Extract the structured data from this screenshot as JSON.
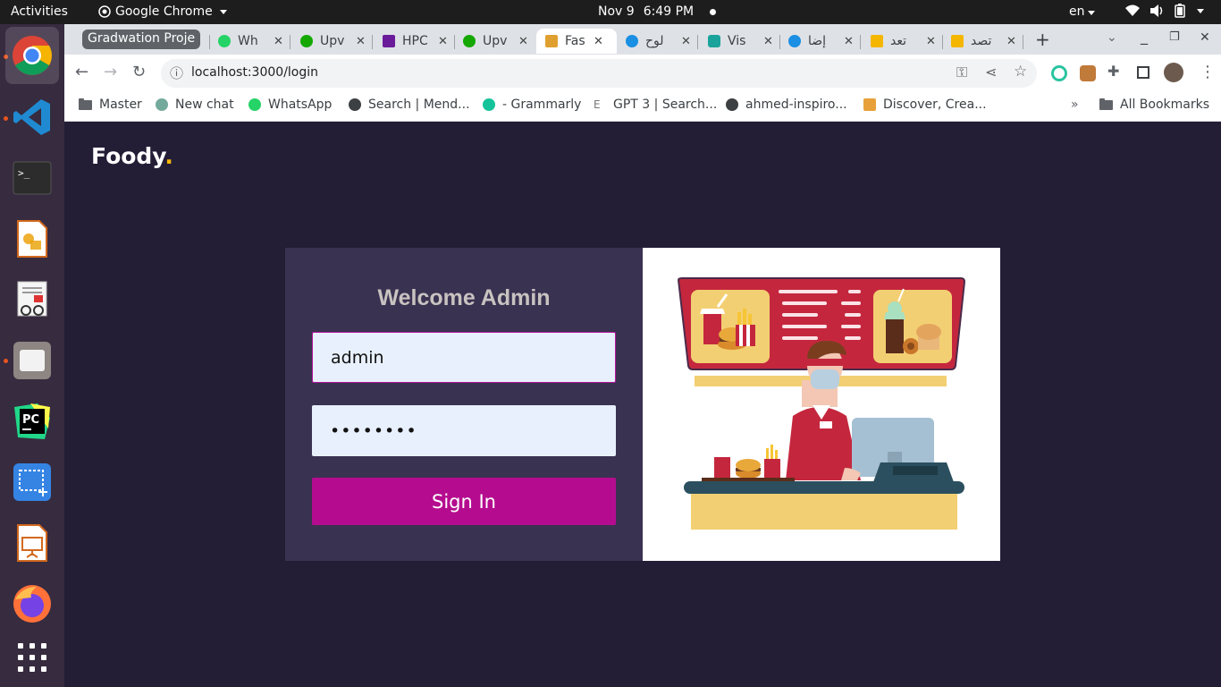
{
  "system": {
    "activities": "Activities",
    "app_menu": "Google Chrome",
    "date": "Nov 9",
    "time": "6:49 PM",
    "language": "en"
  },
  "browser": {
    "tab_group": "Gradwation Proje",
    "tabs": [
      {
        "title": "Wh",
        "color": "#25d366"
      },
      {
        "title": "Upv",
        "color": "#14a800"
      },
      {
        "title": "HPC",
        "color": "#6a1b9a"
      },
      {
        "title": "Upv",
        "color": "#14a800"
      },
      {
        "title": "Fas",
        "color": "#e0a030"
      },
      {
        "title": "لوح",
        "color": "#1a8fe3"
      },
      {
        "title": "Vis",
        "color": "#1aa39b"
      },
      {
        "title": "إضا",
        "color": "#1a8fe3"
      },
      {
        "title": "تعد",
        "color": "#f5b600"
      },
      {
        "title": "تصد",
        "color": "#f5b600"
      }
    ],
    "url": "localhost:3000/login",
    "bookmarks": [
      {
        "label": "Master",
        "icon": "folder-icon"
      },
      {
        "label": "New chat",
        "icon": "openai-icon"
      },
      {
        "label": "WhatsApp",
        "icon": "whatsapp-icon"
      },
      {
        "label": "Search | Mend...",
        "icon": "mendeley-icon"
      },
      {
        "label": "- Grammarly",
        "icon": "grammarly-icon"
      },
      {
        "label": "GPT 3 | Search...",
        "icon": "e-icon"
      },
      {
        "label": "ahmed-inspiro...",
        "icon": "globe-icon"
      },
      {
        "label": "Discover, Crea...",
        "icon": "layers-icon"
      }
    ],
    "all_bookmarks": "All Bookmarks"
  },
  "page": {
    "logo": "Foody",
    "logo_dot": ".",
    "welcome": "Welcome Admin",
    "username_value": "admin",
    "password_value": "••••••••",
    "signin_label": "Sign In"
  },
  "colors": {
    "page_bg": "#231d36",
    "form_panel_bg": "#3a3251",
    "signin_bg": "#b50c8f",
    "logo_accent": "#f5b600"
  }
}
